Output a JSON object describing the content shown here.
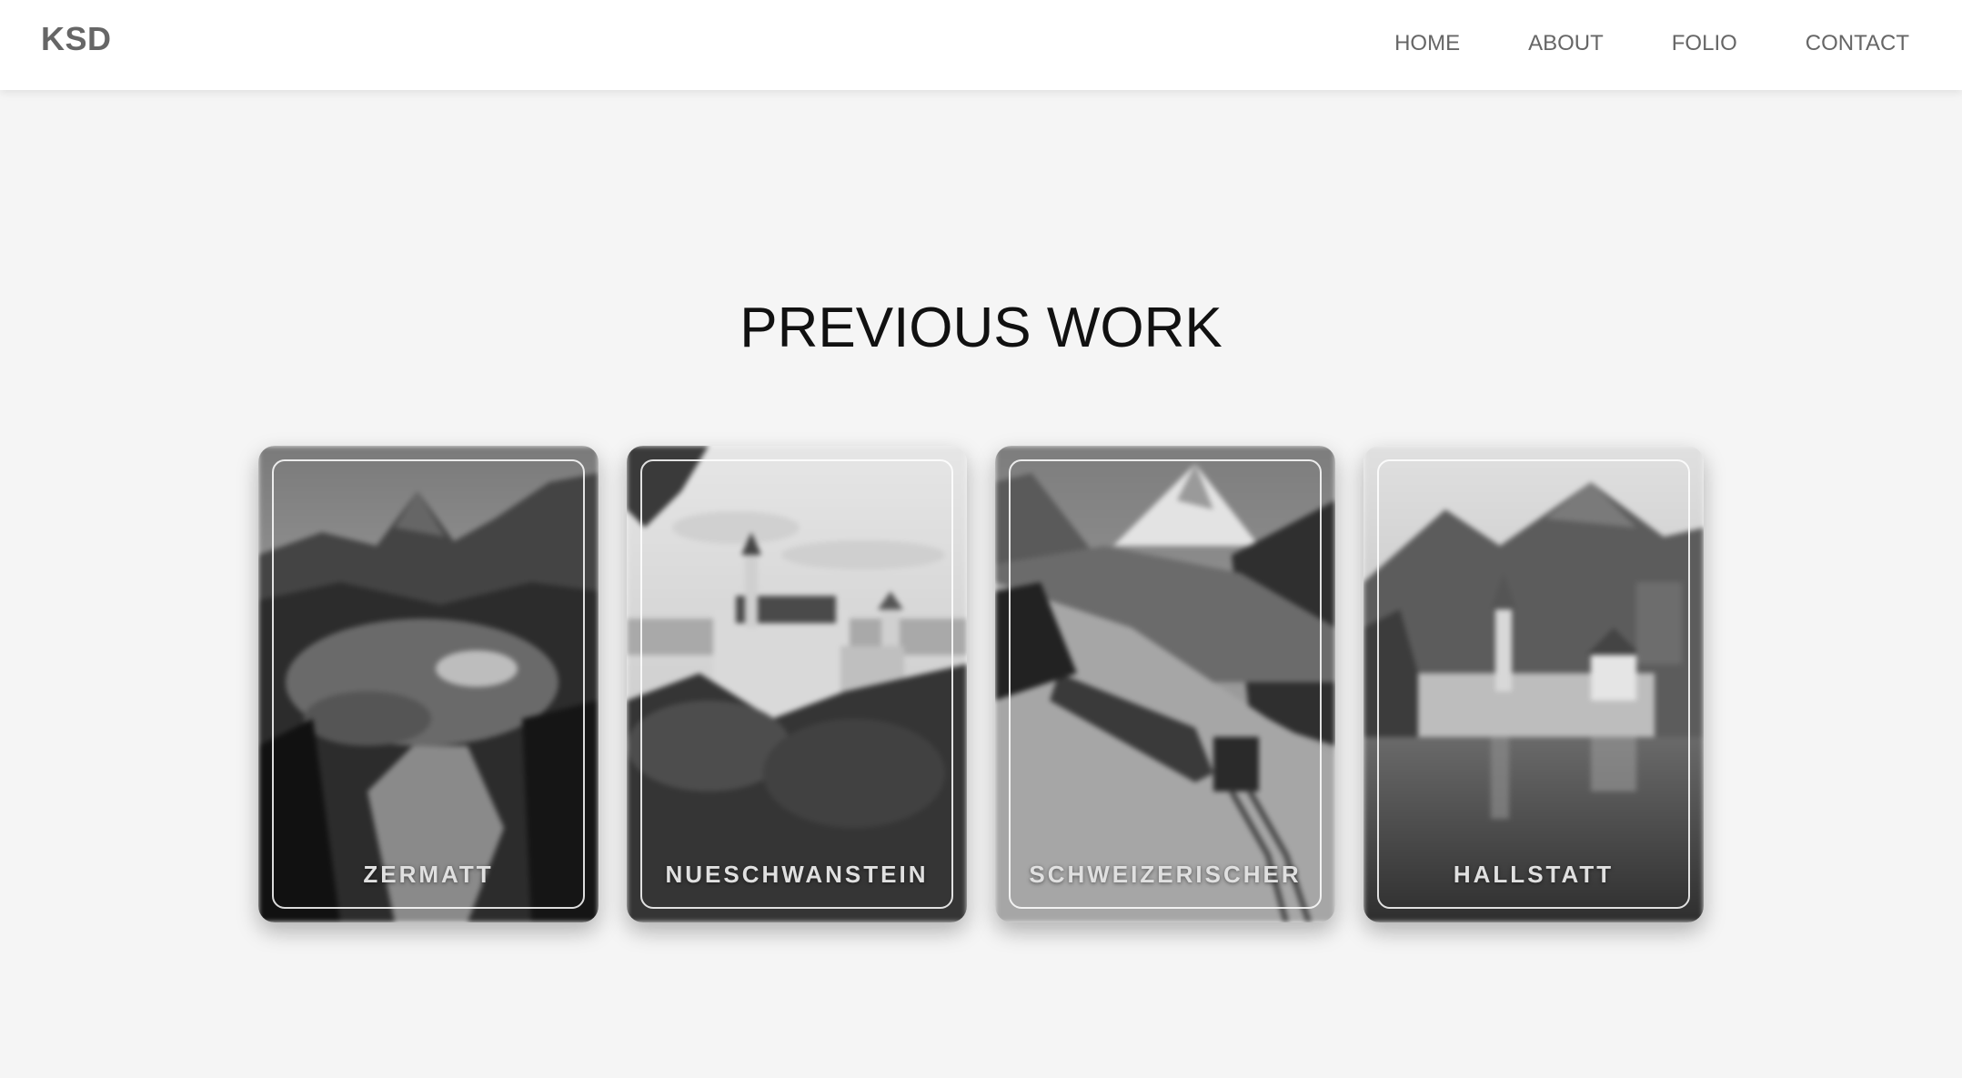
{
  "header": {
    "logo": "KSD",
    "nav": [
      {
        "label": "HOME"
      },
      {
        "label": "ABOUT"
      },
      {
        "label": "FOLIO"
      },
      {
        "label": "CONTACT"
      }
    ]
  },
  "main": {
    "title": "PREVIOUS WORK",
    "cards": [
      {
        "label": "ZERMATT"
      },
      {
        "label": "NUESCHWANSTEIN"
      },
      {
        "label": "SCHWEIZERISCHER"
      },
      {
        "label": "HALLSTATT"
      }
    ]
  },
  "colors": {
    "background": "#f5f5f5",
    "navbar": "#ffffff",
    "nav_text": "#666666",
    "title_text": "#111111"
  }
}
